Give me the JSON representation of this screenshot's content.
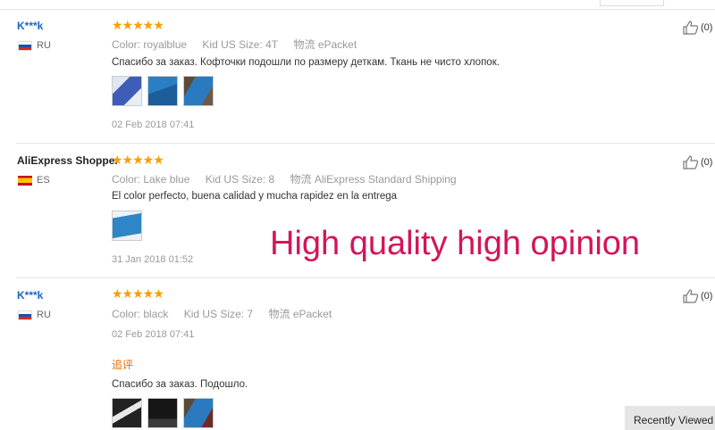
{
  "reviews": [
    {
      "user": "K***k",
      "country": "RU",
      "stars": "★★★★★",
      "color_label": "Color:",
      "color": "royalblue",
      "size_label": "Kid US Size:",
      "size": "4T",
      "ship_label": "物流",
      "ship": "ePacket",
      "text": "Спасибо за заказ. Кофточки подошли по размеру деткам. Ткань не чисто хлопок.",
      "date": "02 Feb 2018 07:41",
      "likes": "(0)"
    },
    {
      "user": "AliExpress Shopper",
      "country": "ES",
      "stars": "★★★★★",
      "color_label": "Color:",
      "color": "Lake blue",
      "size_label": "Kid US Size:",
      "size": "8",
      "ship_label": "物流",
      "ship": "AliExpress Standard Shipping",
      "text": "El color perfecto, buena calidad y mucha rapidez en la entrega",
      "date": "31 Jan 2018 01:52",
      "likes": "(0)"
    },
    {
      "user": "K***k",
      "country": "RU",
      "stars": "★★★★★",
      "color_label": "Color:",
      "color": "black",
      "size_label": "Kid US Size:",
      "size": "7",
      "ship_label": "物流",
      "ship": "ePacket",
      "date": "02 Feb 2018 07:41",
      "additional_label": "追评",
      "text": "Спасибо за заказ. Подошло.",
      "likes": "(0)"
    }
  ],
  "overlay_text": "High quality high opinion",
  "recently_viewed": "Recently Viewed",
  "icons": {
    "like": "thumbs-up-icon"
  }
}
